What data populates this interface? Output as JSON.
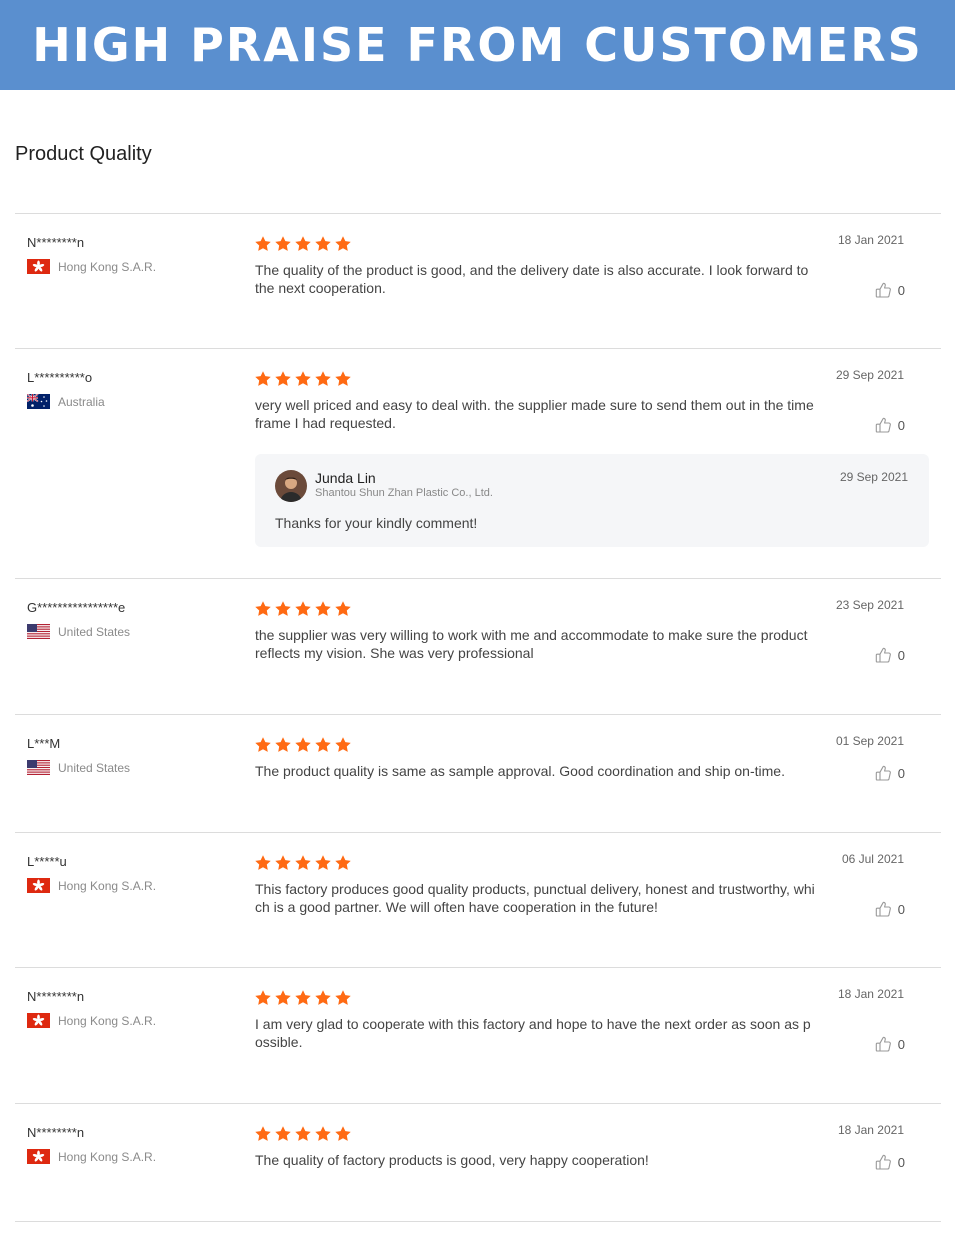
{
  "banner": {
    "title": "HIGH PRAISE FROM CUSTOMERS"
  },
  "section": {
    "title": "Product Quality"
  },
  "colors": {
    "banner": "#5a8fcf",
    "star": "#ff6a13",
    "divider": "#dcdcdc"
  },
  "icons": {
    "star": "star-icon",
    "like": "thumbs-up-icon"
  },
  "reviews": [
    {
      "name": "N********n",
      "country": "Hong Kong S.A.R.",
      "flag": "hk",
      "rating": 5,
      "text": "The quality of the product is good, and the delivery date is also accurate. I look forward to the next cooperation.",
      "date": "18 Jan 2021",
      "likes": "0"
    },
    {
      "name": "L**********o",
      "country": "Australia",
      "flag": "au",
      "rating": 5,
      "text": "very well priced and easy to deal with. the supplier made sure to send them out in the time frame I had requested.",
      "date": "29 Sep 2021",
      "likes": "0",
      "reply": {
        "name": "Junda Lin",
        "company": "Shantou Shun Zhan Plastic Co., Ltd.",
        "date": "29 Sep 2021",
        "text": "Thanks for your kindly comment!"
      }
    },
    {
      "name": "G****************e",
      "country": "United States",
      "flag": "us",
      "rating": 5,
      "text": "the supplier was very willing to work with me and accommodate to make sure the product reflects my vision. She was very professional",
      "date": "23 Sep 2021",
      "likes": "0"
    },
    {
      "name": "L***M",
      "country": "United States",
      "flag": "us",
      "rating": 5,
      "text": "The product quality is same as sample approval. Good coordination and ship on-time.",
      "date": "01 Sep 2021",
      "likes": "0"
    },
    {
      "name": "L*****u",
      "country": "Hong Kong S.A.R.",
      "flag": "hk",
      "rating": 5,
      "text": "This factory produces good quality products, punctual delivery, honest and trustworthy, which is a good partner. We will often have cooperation in the future!",
      "date": "06 Jul 2021",
      "likes": "0"
    },
    {
      "name": "N********n",
      "country": "Hong Kong S.A.R.",
      "flag": "hk",
      "rating": 5,
      "text": "I am very glad to cooperate with this factory and hope to have the next order as soon as possible.",
      "date": "18 Jan 2021",
      "likes": "0"
    },
    {
      "name": "N********n",
      "country": "Hong Kong S.A.R.",
      "flag": "hk",
      "rating": 5,
      "text": "The quality of factory products is good, very happy cooperation!",
      "date": "18 Jan 2021",
      "likes": "0"
    }
  ]
}
